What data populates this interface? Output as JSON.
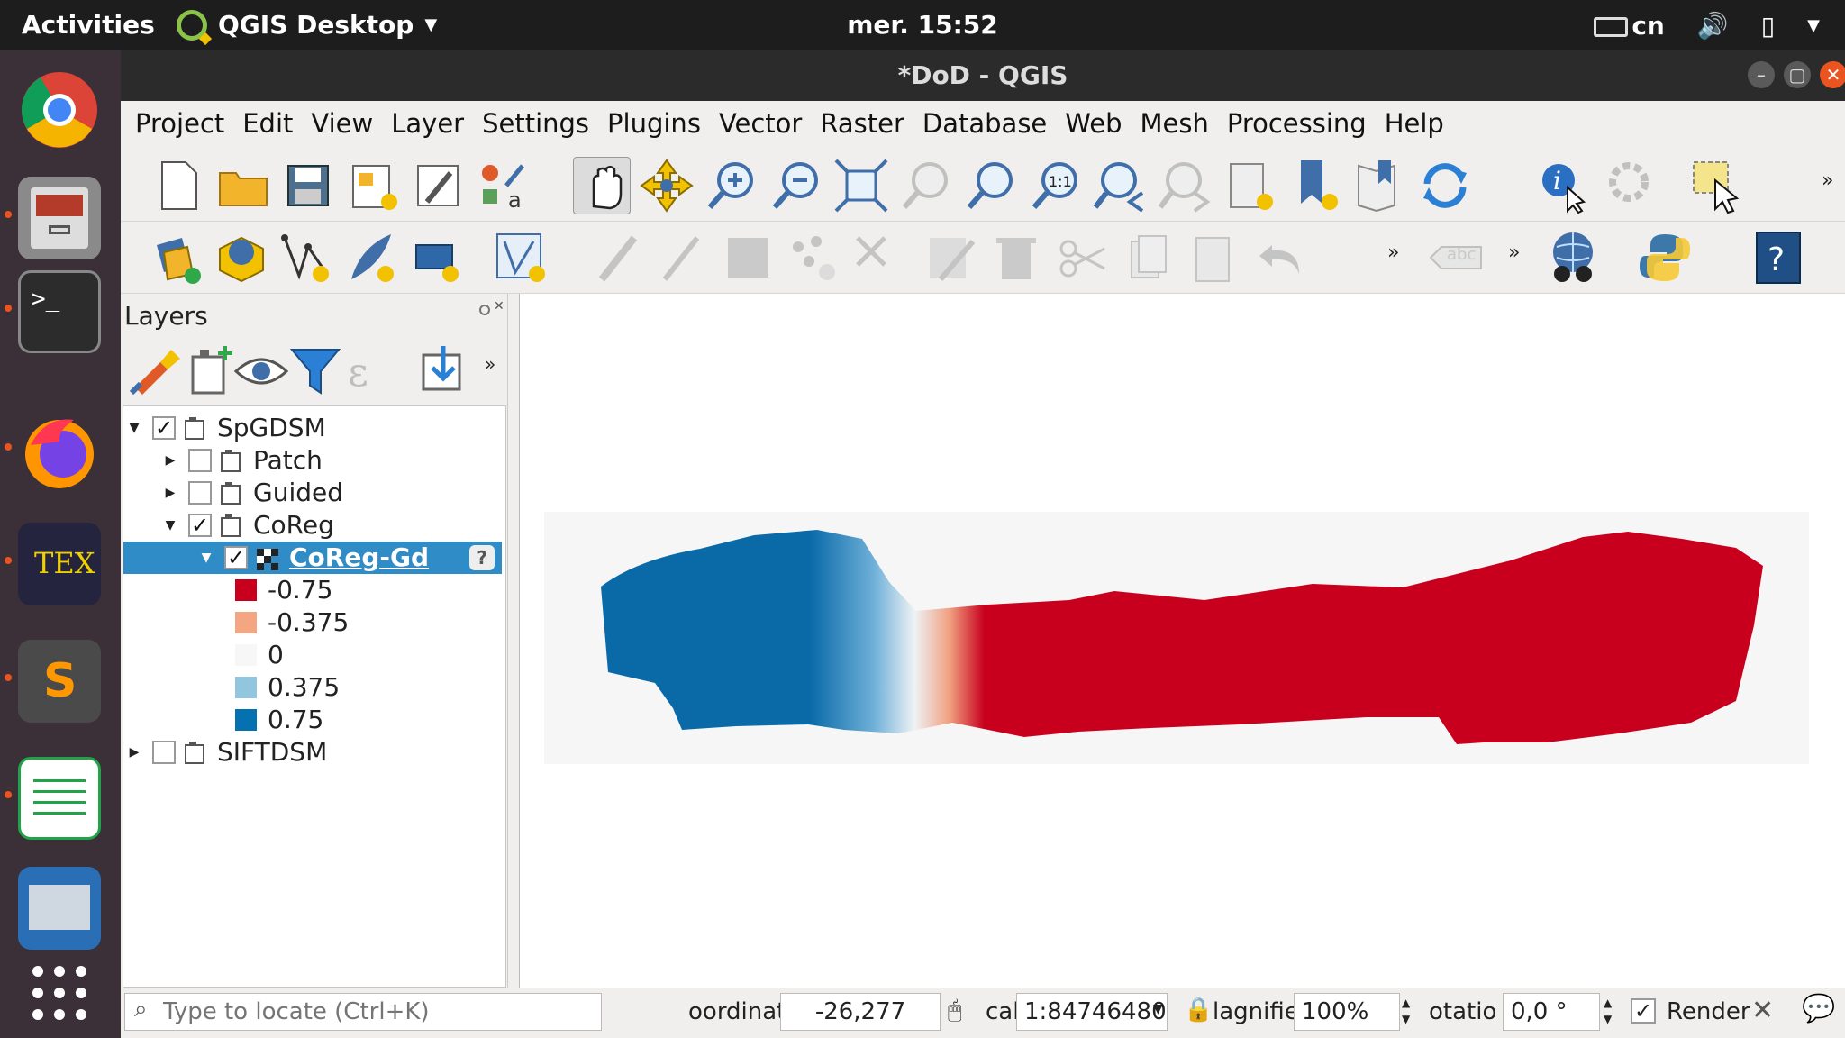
{
  "topbar": {
    "activities": "Activities",
    "app": "QGIS Desktop",
    "clock": "mer. 15:52",
    "keyboard": "cn"
  },
  "window": {
    "title": "*DoD - QGIS"
  },
  "menu": [
    "Project",
    "Edit",
    "View",
    "Layer",
    "Settings",
    "Plugins",
    "Vector",
    "Raster",
    "Database",
    "Web",
    "Mesh",
    "Processing",
    "Help"
  ],
  "layers_panel": {
    "title": "Layers",
    "tree": [
      {
        "name": "SpGDSM",
        "checked": true
      },
      {
        "name": "Patch",
        "checked": false
      },
      {
        "name": "Guided",
        "checked": false
      },
      {
        "name": "CoReg",
        "checked": true
      },
      {
        "name": "CoReg-Gd",
        "checked": true
      },
      {
        "name": "SIFTDSM",
        "checked": false
      }
    ],
    "legend": [
      {
        "label": "-0.75",
        "color": "#c8001e"
      },
      {
        "label": "-0.375",
        "color": "#f4a582"
      },
      {
        "label": "0",
        "color": "#f7f7f7"
      },
      {
        "label": "0.375",
        "color": "#92c5de"
      },
      {
        "label": "0.75",
        "color": "#0571b0"
      }
    ]
  },
  "toolbar": {
    "overflow": "»",
    "label_tool": "abc"
  },
  "status": {
    "locate_placeholder": "Type to locate (Ctrl+K)",
    "coord_label": "oordinat",
    "coord_value": "-26,277",
    "scale_label": "cal",
    "scale_value": "1:84746480",
    "magnifier_label": "lagnifie",
    "magnifier_value": "100%",
    "rotation_label": "otatio",
    "rotation_value": "0,0 °",
    "render_label": "Render"
  }
}
